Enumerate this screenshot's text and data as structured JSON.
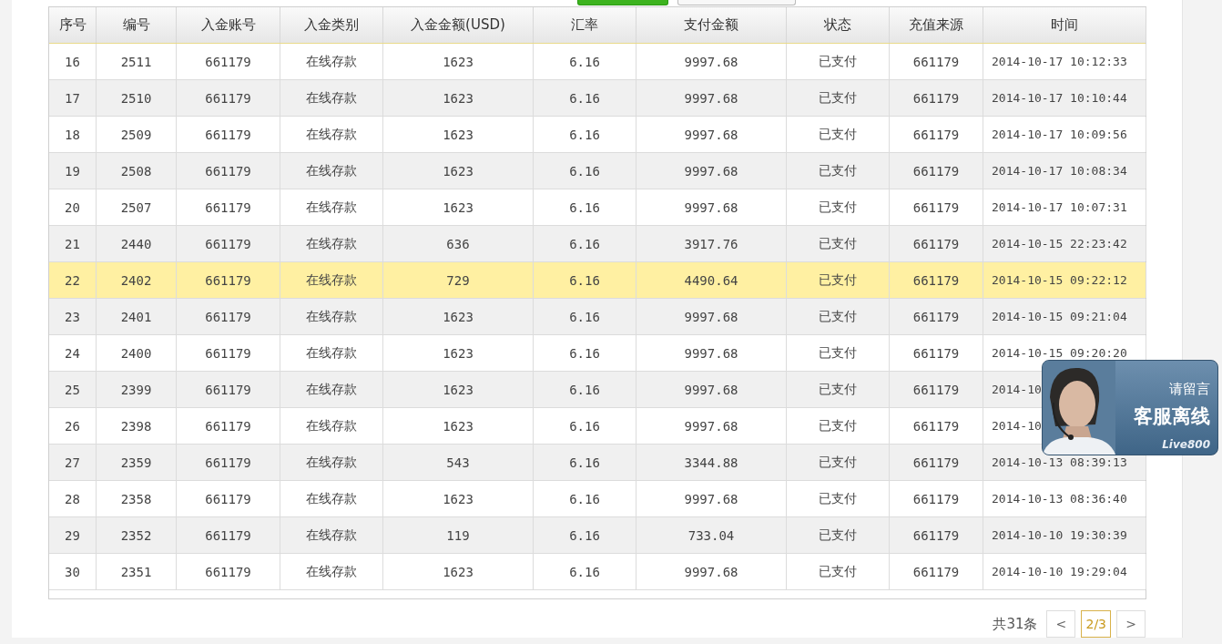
{
  "table": {
    "columns": [
      "序号",
      "编号",
      "入金账号",
      "入金类别",
      "入金金额(USD)",
      "汇率",
      "支付金额",
      "状态",
      "充值来源",
      "时间"
    ],
    "rows": [
      {
        "selected": false,
        "cells": [
          "16",
          "2511",
          "661179",
          "在线存款",
          "1623",
          "6.16",
          "9997.68",
          "已支付",
          "661179",
          "2014-10-17 10:12:33"
        ]
      },
      {
        "selected": false,
        "cells": [
          "17",
          "2510",
          "661179",
          "在线存款",
          "1623",
          "6.16",
          "9997.68",
          "已支付",
          "661179",
          "2014-10-17 10:10:44"
        ]
      },
      {
        "selected": false,
        "cells": [
          "18",
          "2509",
          "661179",
          "在线存款",
          "1623",
          "6.16",
          "9997.68",
          "已支付",
          "661179",
          "2014-10-17 10:09:56"
        ]
      },
      {
        "selected": false,
        "cells": [
          "19",
          "2508",
          "661179",
          "在线存款",
          "1623",
          "6.16",
          "9997.68",
          "已支付",
          "661179",
          "2014-10-17 10:08:34"
        ]
      },
      {
        "selected": false,
        "cells": [
          "20",
          "2507",
          "661179",
          "在线存款",
          "1623",
          "6.16",
          "9997.68",
          "已支付",
          "661179",
          "2014-10-17 10:07:31"
        ]
      },
      {
        "selected": false,
        "cells": [
          "21",
          "2440",
          "661179",
          "在线存款",
          "636",
          "6.16",
          "3917.76",
          "已支付",
          "661179",
          "2014-10-15 22:23:42"
        ]
      },
      {
        "selected": true,
        "cells": [
          "22",
          "2402",
          "661179",
          "在线存款",
          "729",
          "6.16",
          "4490.64",
          "已支付",
          "661179",
          "2014-10-15 09:22:12"
        ]
      },
      {
        "selected": false,
        "cells": [
          "23",
          "2401",
          "661179",
          "在线存款",
          "1623",
          "6.16",
          "9997.68",
          "已支付",
          "661179",
          "2014-10-15 09:21:04"
        ]
      },
      {
        "selected": false,
        "cells": [
          "24",
          "2400",
          "661179",
          "在线存款",
          "1623",
          "6.16",
          "9997.68",
          "已支付",
          "661179",
          "2014-10-15 09:20:20"
        ]
      },
      {
        "selected": false,
        "cells": [
          "25",
          "2399",
          "661179",
          "在线存款",
          "1623",
          "6.16",
          "9997.68",
          "已支付",
          "661179",
          "2014-10"
        ]
      },
      {
        "selected": false,
        "cells": [
          "26",
          "2398",
          "661179",
          "在线存款",
          "1623",
          "6.16",
          "9997.68",
          "已支付",
          "661179",
          "2014-10"
        ]
      },
      {
        "selected": false,
        "cells": [
          "27",
          "2359",
          "661179",
          "在线存款",
          "543",
          "6.16",
          "3344.88",
          "已支付",
          "661179",
          "2014-10-13 08:39:13"
        ]
      },
      {
        "selected": false,
        "cells": [
          "28",
          "2358",
          "661179",
          "在线存款",
          "1623",
          "6.16",
          "9997.68",
          "已支付",
          "661179",
          "2014-10-13 08:36:40"
        ]
      },
      {
        "selected": false,
        "cells": [
          "29",
          "2352",
          "661179",
          "在线存款",
          "119",
          "6.16",
          "733.04",
          "已支付",
          "661179",
          "2014-10-10 19:30:39"
        ]
      },
      {
        "selected": false,
        "cells": [
          "30",
          "2351",
          "661179",
          "在线存款",
          "1623",
          "6.16",
          "9997.68",
          "已支付",
          "661179",
          "2014-10-10 19:29:04"
        ]
      }
    ]
  },
  "pagination": {
    "total": "共31条",
    "prev": "<",
    "page": "2/3",
    "next": ">"
  },
  "chat_widget": {
    "prompt": "请留言",
    "status": "客服离线",
    "brand": "Live800"
  }
}
